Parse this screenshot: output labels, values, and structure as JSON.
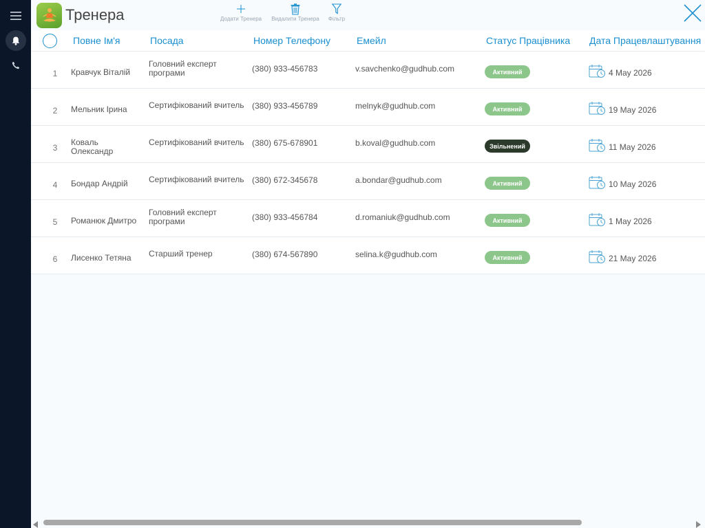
{
  "app": {
    "title": "Тренера",
    "icon": "yoga-app-icon"
  },
  "toolbar": {
    "add_label": "Додати Тренера",
    "delete_label": "Видалити Тренера",
    "filter_label": "Фільтр"
  },
  "sidebar": {
    "items": [
      "menu-icon",
      "bell-icon",
      "phone-icon"
    ]
  },
  "columns": {
    "name": "Повне Ім'я",
    "position": "Посада",
    "phone": "Номер Телефону",
    "email": "Емейл",
    "status": "Статус Працівника",
    "hire_date": "Дата Працевлаштування"
  },
  "rows": [
    {
      "num": "1",
      "name": "Кравчук Віталій",
      "position": "Головний експерт програми",
      "phone": "(380) 933-456783",
      "email": "v.savchenko@gudhub.com",
      "status": "Активний",
      "date": "4 May 2026"
    },
    {
      "num": "2",
      "name": "Мельник Ірина",
      "position": "Сертифікований вчитель",
      "phone": "(380) 933-456789",
      "email": "melnyk@gudhub.com",
      "status": "Активний",
      "date": "19 May 2026"
    },
    {
      "num": "3",
      "name": "Коваль Олександр",
      "position": "Сертифікований вчитель",
      "phone": "(380) 675-678901",
      "email": "b.koval@gudhub.com",
      "status": "Звільнений",
      "date": "11 May 2026"
    },
    {
      "num": "4",
      "name": "Бондар Андрій",
      "position": "Сертифікований вчитель",
      "phone": "(380) 672-345678",
      "email": "a.bondar@gudhub.com",
      "status": "Активний",
      "date": "10 May 2026"
    },
    {
      "num": "5",
      "name": "Романюк Дмитро",
      "position": "Головний експерт програми",
      "phone": "(380) 933-456784",
      "email": "d.romaniuk@gudhub.com",
      "status": "Активний",
      "date": "1 May 2026"
    },
    {
      "num": "6",
      "name": "Лисенко Тетяна",
      "position": "Старший тренер",
      "phone": "(380) 674-567890",
      "email": "selina.k@gudhub.com",
      "status": "Активний",
      "date": "21 May 2026"
    }
  ],
  "colors": {
    "accent": "#1a8fd0",
    "active_badge": "#8cc68a",
    "dismissed_badge": "#2c3a2c",
    "sidebar": "#0b1628"
  }
}
